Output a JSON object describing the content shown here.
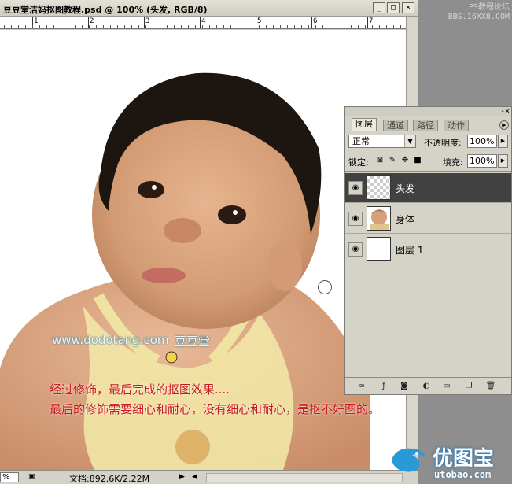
{
  "window": {
    "title": "豆豆堂洁妈抠图教程.psd @ 100% (头发, RGB/8)",
    "minimize": "_",
    "maximize": "□",
    "close": "×"
  },
  "ruler": {
    "numbers": [
      "1",
      "2",
      "3",
      "4",
      "5",
      "6",
      "7"
    ]
  },
  "status": {
    "zoom": "%",
    "doc_info": "文档:892.6K/2.22M"
  },
  "forum": {
    "line1": "PS教程论坛",
    "line2": "BBS.16XX8.COM"
  },
  "caption": {
    "site_url": "www.dodotang.com",
    "brand": "豆豆堂",
    "line1": "经过修饰，最后完成的抠图效果....",
    "line2": "最后的修饰需要细心和耐心，没有细心和耐心，是抠不好图的。"
  },
  "layers_panel": {
    "tabs": [
      {
        "label": "图层",
        "active": true
      },
      {
        "label": "通道",
        "active": false
      },
      {
        "label": "路径",
        "active": false
      },
      {
        "label": "动作",
        "active": false
      }
    ],
    "blend_mode": "正常",
    "opacity_label": "不透明度:",
    "opacity_value": "100%",
    "lock_label": "锁定:",
    "fill_label": "填充:",
    "fill_value": "100%",
    "layers": [
      {
        "name": "头发",
        "selected": true,
        "thumb": "transparent"
      },
      {
        "name": "身体",
        "selected": false,
        "thumb": "photo"
      },
      {
        "name": "图层 1",
        "selected": false,
        "thumb": "white"
      }
    ]
  },
  "watermark": {
    "text": "优图宝",
    "domain": "utobao.com"
  },
  "colors": {
    "caption_red": "#c81a1a",
    "selected_layer": "#414141",
    "watermark_blue": "#2a7ab0"
  }
}
